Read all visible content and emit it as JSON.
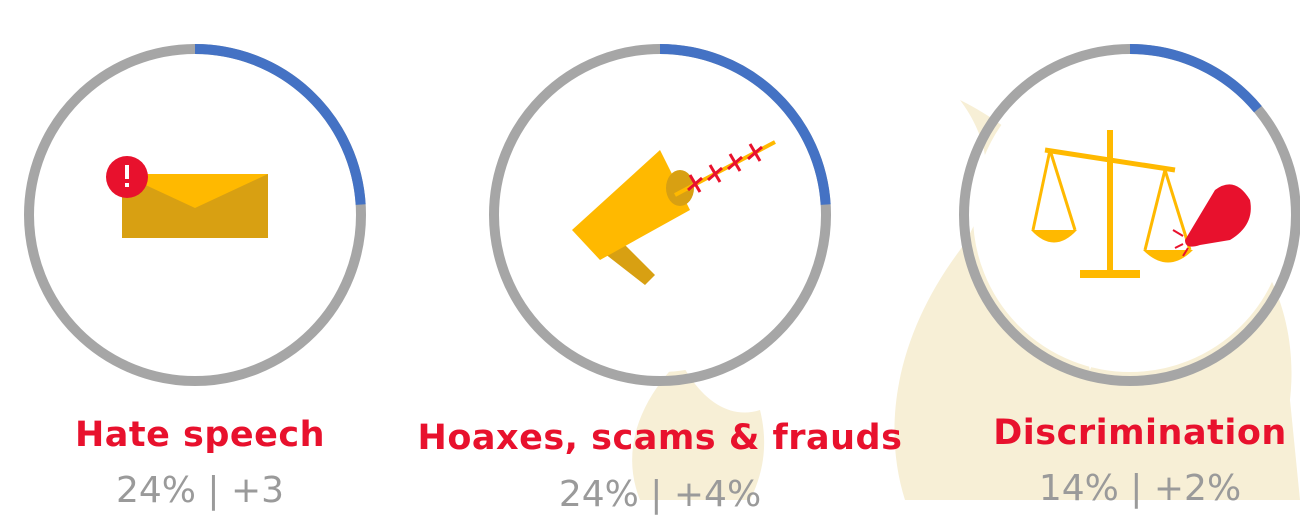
{
  "colors": {
    "accent_blue": "#4472C4",
    "track_grey": "#A6A6A6",
    "label_red": "#E8112D",
    "icon_gold": "#FFB900",
    "icon_dark_gold": "#D8A012",
    "background_flame": "#F7EFD6"
  },
  "chart_data": {
    "type": "pie",
    "variant": "donut-progress",
    "items": [
      {
        "label": "Hate speech",
        "percent": 24,
        "change_text": "+3",
        "value_text": "24% | +3",
        "icon": "envelope-alert-icon"
      },
      {
        "label": "Hoaxes, scams & frauds",
        "percent": 24,
        "change_text": "+4%",
        "value_text": "24% | +4%",
        "icon": "megaphone-barbed-wire-icon"
      },
      {
        "label": "Discrimination",
        "percent": 14,
        "change_text": "+2%",
        "value_text": "14% | +2%",
        "icon": "scales-hand-icon"
      }
    ]
  }
}
